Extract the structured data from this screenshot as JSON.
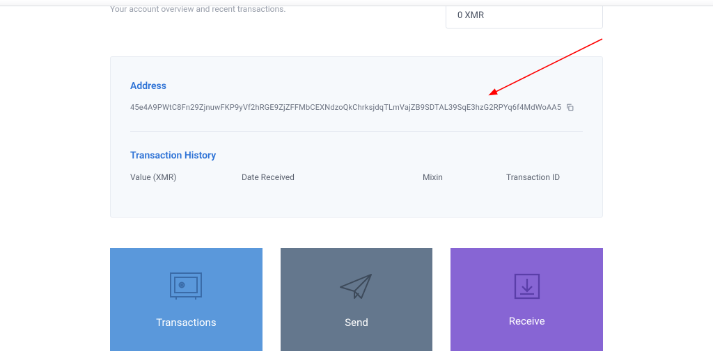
{
  "overview_text": "Your account overview and recent transactions.",
  "balance_text": "0 XMR",
  "address": {
    "label": "Address",
    "value": "45e4A9PWtC8Fn29ZjnuwFKP9yVf2hRGE9ZjZFFMbCEXNdzoQkChrksjdqTLmVajZB9SDTAL39SqE3hzG2RPYq6f4MdWoAA5"
  },
  "history": {
    "label": "Transaction History",
    "columns": {
      "value": "Value (XMR)",
      "date": "Date Received",
      "mixin": "Mixin",
      "txid": "Transaction ID"
    }
  },
  "cards": {
    "transactions": "Transactions",
    "send": "Send",
    "receive": "Receive"
  }
}
